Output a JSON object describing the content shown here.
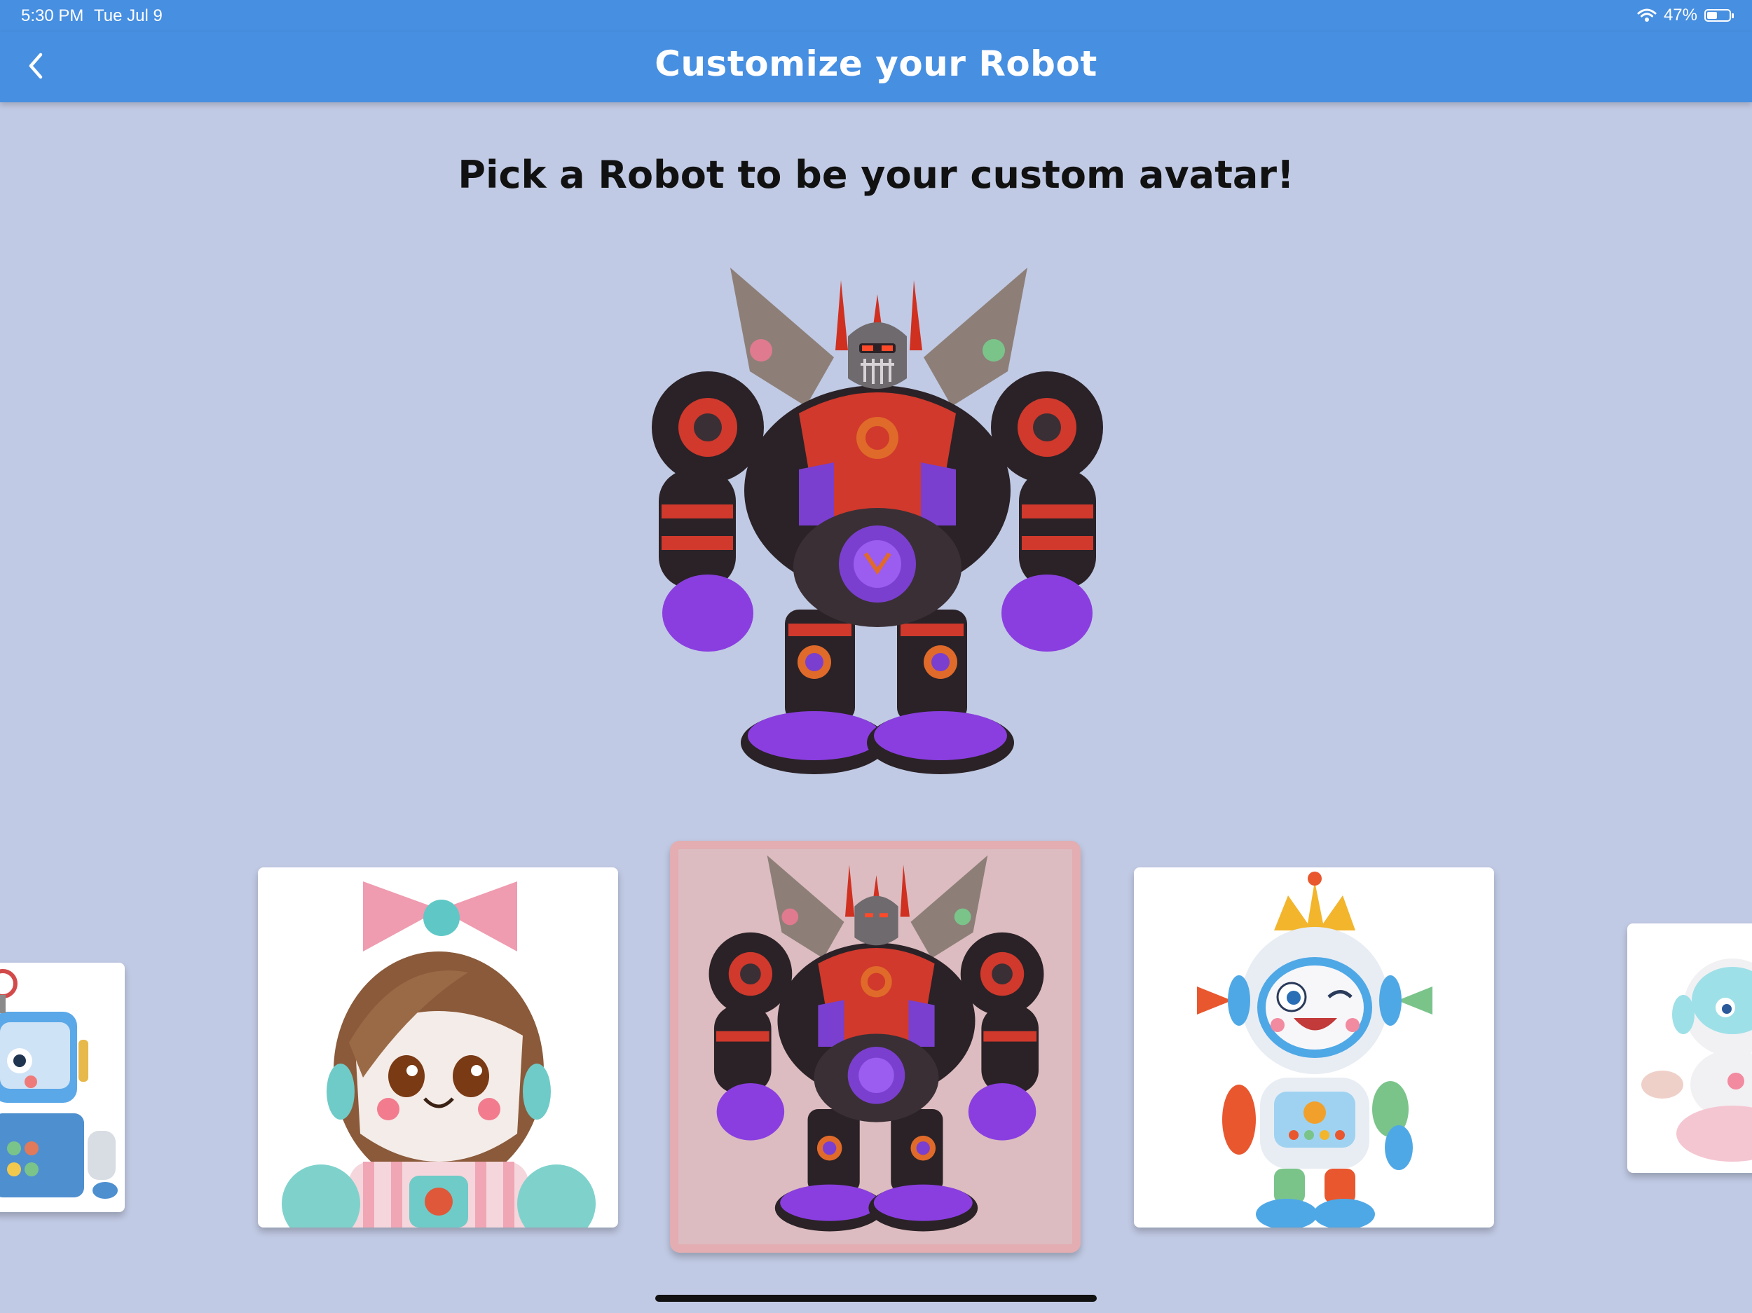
{
  "status_bar": {
    "time": "5:30 PM",
    "date": "Tue Jul 9",
    "battery_text": "47%",
    "battery_level": 0.47
  },
  "nav": {
    "title": "Customize your Robot"
  },
  "main": {
    "heading": "Pick a Robot to be your custom avatar!"
  },
  "carousel": {
    "items": [
      {
        "name": "retro blue robot"
      },
      {
        "name": "girl robot with pink bow"
      },
      {
        "name": "armored red and purple robot",
        "selected": true
      },
      {
        "name": "robot with crown"
      },
      {
        "name": "pastel girl robot"
      }
    ]
  },
  "colors": {
    "accent": "#478fe1",
    "background": "#c1cae4",
    "selected_card": "#dcbcc0"
  },
  "icons": [
    "back-icon",
    "wifi-icon",
    "battery-icon"
  ]
}
